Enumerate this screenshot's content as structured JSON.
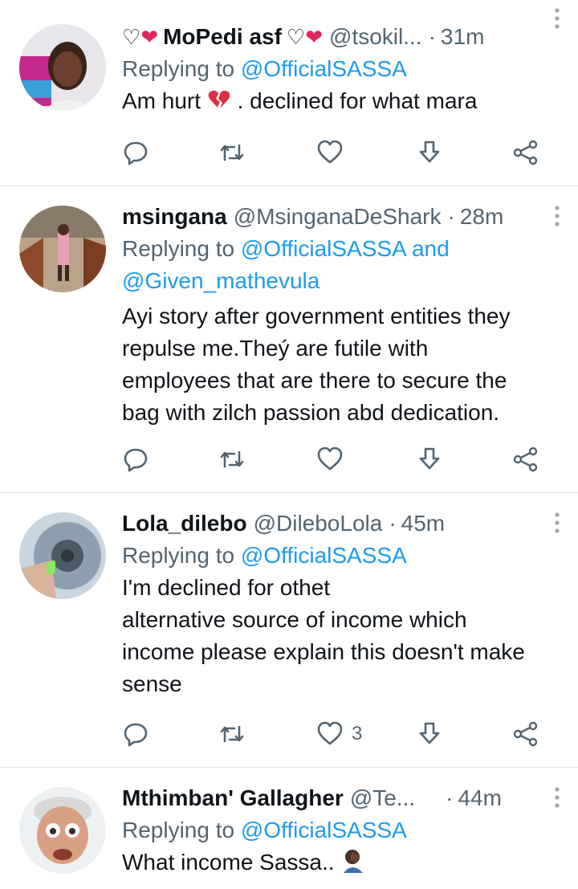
{
  "tweets": [
    {
      "name_prefix": "♡",
      "name": "MoPedi asf",
      "name_suffix": "♡",
      "handle": "@tsokil...",
      "time": "31m",
      "reply_prefix": "Replying to",
      "mentions": "@OfficialSASSA",
      "mentions2": "",
      "text_lines": [
        "Am hurt",
        ". declined for what mara"
      ],
      "likes": ""
    },
    {
      "name": "msingana",
      "handle": "@MsinganaDeShark",
      "time": "28m",
      "reply_prefix": "Replying to",
      "mentions": "@OfficialSASSA and",
      "mentions2": "@Given_mathevula",
      "text_lines": [
        "Ayi story after government entities they",
        "repulse me.Theý are futile with",
        "employees that are there to secure the",
        "bag with zilch passion abd dedication."
      ],
      "likes": ""
    },
    {
      "name": "Lola_dilebo",
      "handle": "@DileboLola",
      "time": "45m",
      "reply_prefix": "Replying to",
      "mentions": "@OfficialSASSA",
      "mentions2": "",
      "text_lines": [
        "I'm declined for othet",
        "alternative source of income which",
        "income please explain this doesn't make",
        "sense"
      ],
      "likes": "3"
    },
    {
      "name": "Mthimban' Gallagher",
      "handle": "@Te...",
      "time": "44m",
      "reply_prefix": "Replying to",
      "mentions": "@OfficialSASSA",
      "mentions2": "",
      "text_lines": [
        "What income Sassa.."
      ],
      "likes": ""
    }
  ],
  "icons": {
    "reply": "reply-icon",
    "retweet": "retweet-icon",
    "like": "heart-icon",
    "bookmark": "bookmark-icon",
    "share": "share-icon",
    "more": "more-vertical-icon"
  },
  "colors": {
    "mention": "#1d9bf0",
    "secondary": "#536471",
    "heart": "#e0245e",
    "text": "#0f1419"
  }
}
